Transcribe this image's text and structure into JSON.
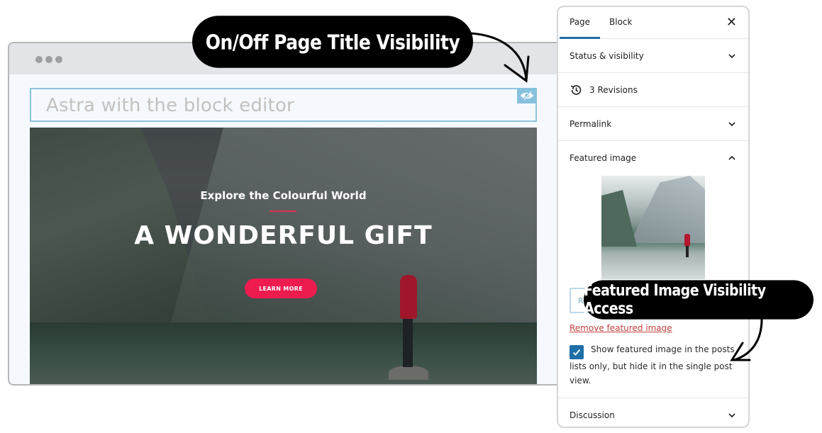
{
  "browser": {
    "page_title_placeholder": "Astra with the block editor",
    "title_visibility_icon": "eye-slash-icon",
    "hero": {
      "subtitle": "Explore the Colourful World",
      "title": "A WONDERFUL GIFT",
      "button_label": "LEARN MORE",
      "accent_color": "#ee1b4f"
    }
  },
  "callouts": {
    "title_visibility": "On/Off Page Title Visibility",
    "featured_visibility": "Featured Image Visibility Access"
  },
  "sidebar": {
    "tabs": [
      {
        "label": "Page",
        "active": true
      },
      {
        "label": "Block",
        "active": false
      }
    ],
    "close_icon": "close-icon",
    "sections": {
      "status": {
        "label": "Status & visibility",
        "expanded": false
      },
      "revisions": {
        "label": "3 Revisions",
        "icon": "history-icon"
      },
      "permalink": {
        "label": "Permalink",
        "expanded": false
      },
      "featured": {
        "label": "Featured image",
        "expanded": true,
        "replace_label": "Replace",
        "remove_label": "Remove featured image",
        "checkbox_checked": true,
        "checkbox_label": "Show featured image in the posts lists only, but hide it in the single post view."
      },
      "discussion": {
        "label": "Discussion",
        "expanded": false
      }
    },
    "accent_color": "#1f6fa8"
  }
}
